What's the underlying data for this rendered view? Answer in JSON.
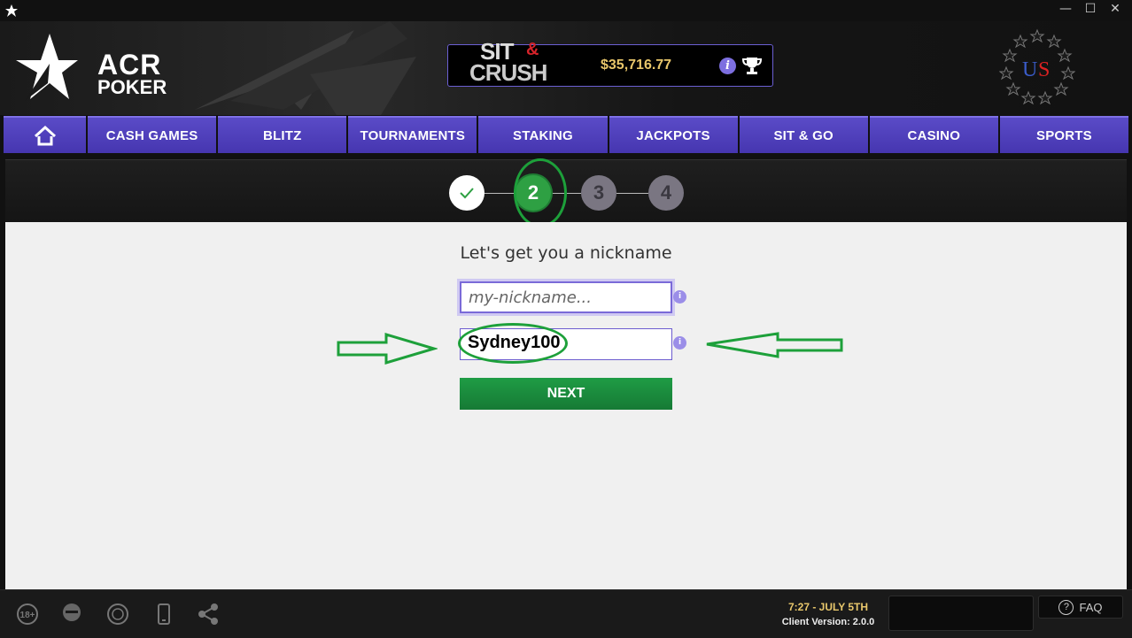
{
  "window": {
    "app_icon": "acr-star-icon",
    "controls": [
      "minimize",
      "maximize",
      "close"
    ]
  },
  "header": {
    "logo": {
      "line1": "ACR",
      "line2": "POKER"
    },
    "promo": {
      "brand_top": "SIT",
      "brand_amp": "&",
      "brand_bottom": "CRUSH",
      "amount": "$35,716.77",
      "info_label": "i"
    },
    "badge": {
      "text_u": "U",
      "text_s": "S"
    }
  },
  "nav": {
    "items": [
      {
        "label": "CASH GAMES"
      },
      {
        "label": "BLITZ"
      },
      {
        "label": "TOURNAMENTS"
      },
      {
        "label": "STAKING"
      },
      {
        "label": "JACKPOTS"
      },
      {
        "label": "SIT & GO"
      },
      {
        "label": "CASINO"
      },
      {
        "label": "SPORTS"
      }
    ]
  },
  "stepper": {
    "steps": [
      {
        "label": "✓",
        "state": "done"
      },
      {
        "label": "2",
        "state": "active"
      },
      {
        "label": "3",
        "state": "todo"
      },
      {
        "label": "4",
        "state": "todo"
      }
    ]
  },
  "form": {
    "heading": "Let's get you a nickname",
    "nickname_placeholder": "my-nickname...",
    "nickname_value": "Sydney100",
    "info_label": "i",
    "next_label": "NEXT"
  },
  "footer": {
    "time": "7:27 - JULY 5TH",
    "version": "Client Version: 2.0.0",
    "age_label": "18+",
    "faq_label": "FAQ",
    "faq_icon": "?"
  },
  "colors": {
    "accent": "#5a4bc7",
    "success": "#2ea043",
    "gold": "#e8c66a"
  }
}
